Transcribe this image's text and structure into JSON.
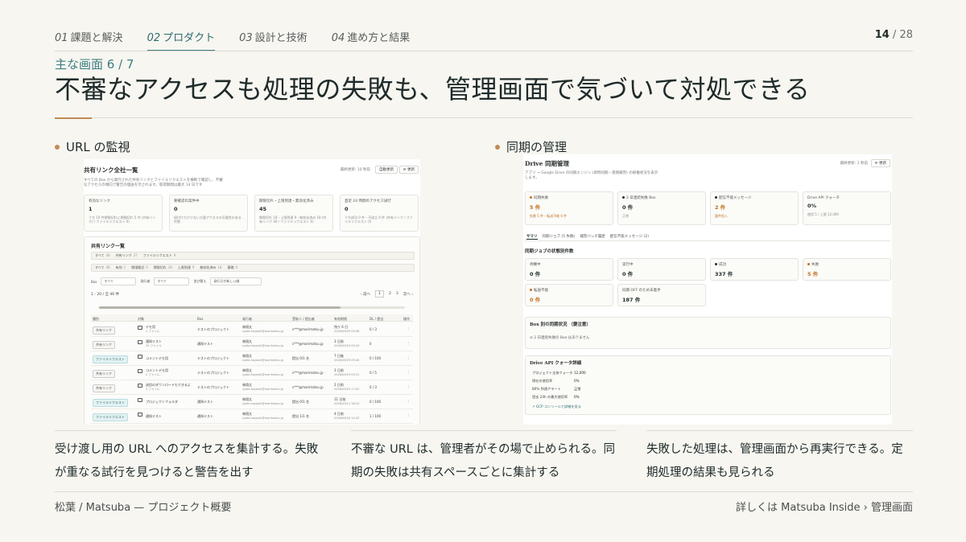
{
  "nav": {
    "tabs": [
      {
        "num": "01",
        "label": "課題と解決"
      },
      {
        "num": "02",
        "label": "プロダクト"
      },
      {
        "num": "03",
        "label": "設計と技術"
      },
      {
        "num": "04",
        "label": "進め方と結果"
      }
    ],
    "active_tab": 1,
    "page_current": "14",
    "page_sep": "/",
    "page_total": "28"
  },
  "section_label": "主な画面 6 / 7",
  "title": "不審なアクセスも処理の失敗も、管理画面で気づいて対処できる",
  "left_panel": {
    "heading": "URL の監視",
    "shot": {
      "title": "共有リンク全社一覧",
      "updated": "最終更新: 10 秒前",
      "btn_refresh_auto": "自動更新",
      "btn_refresh": "⟳ 更新",
      "desc1": "すべての Box から発行された共有リンクとファイルリクエストを横断で確認し、不審",
      "desc2": "なアクセスの傾向で警告の理由を示されます。取得期間は最大 14 日です",
      "cards": [
        {
          "label": "有効なリンク",
          "value": "1",
          "note": "うち 10 件期限切れに期間切れ 5 件 (共有リンク) / ファイルリクエスト 0)"
        },
        {
          "label": "要確認の案件中",
          "value": "0",
          "note": "紐付けだけ少ない大量アクセスの可能性のある件数"
        },
        {
          "label": "期限切れ・上限到達・無効化済み",
          "value": "45",
          "note": "期限切れ 18・上限到達 9・無効化済み 18 (共有リンク 36 / ファイルリクエスト 9)"
        },
        {
          "label": "直近 24 時間のアクセス試行",
          "value": "0",
          "note": "うち成功 0 件・不成立 0 件 (共有リンク / ファイルリクエスト 0)"
        }
      ],
      "list_title": "共有リンク一覧",
      "chips1": [
        {
          "label": "すべて",
          "count": "46"
        },
        {
          "label": "共有リンク",
          "count": "37"
        },
        {
          "label": "ファイルリクエスト",
          "count": "9"
        }
      ],
      "chips2": [
        {
          "label": "すべて",
          "count": "46"
        },
        {
          "label": "有効",
          "count": "1"
        },
        {
          "label": "期限間近",
          "count": "0"
        },
        {
          "label": "期限切れ",
          "count": "18"
        },
        {
          "label": "上限到達",
          "count": "9"
        },
        {
          "label": "無効化済み",
          "count": "18"
        },
        {
          "label": "要確",
          "count": "0"
        }
      ],
      "filter_box_label": "Box",
      "filter_box_value": "すべて",
      "filter_issuer_label": "発行者",
      "filter_issuer_value": "すべて",
      "filter_sort_label": "並び替え",
      "filter_sort_value": "発行日が新しい順",
      "range": "1 - 20 / 全 46 件",
      "prev": "前へ",
      "pages": [
        "1",
        "2",
        "3"
      ],
      "next": "次へ",
      "headers": [
        "種別",
        "対象",
        "Box",
        "発行者",
        "受取人 / 提出者",
        "有効期限",
        "DL / 提出",
        "操作"
      ],
      "rows": [
        {
          "type": "共有リンク",
          "kind": "link",
          "target": "デモ用",
          "sub": "1 ファイル",
          "box": "テストのプロジェクト",
          "issuer": "林翔太",
          "email": "syota.hayashi@morimatsu.jp",
          "recipient": "s***@morimatsu.jp",
          "exp": "残り 6 日",
          "exp2": "2026/09/29 09:08",
          "dl": "0 / 3"
        },
        {
          "type": "共有リンク",
          "kind": "link",
          "target": "通知テスト",
          "sub": "25 ファイル",
          "box": "通知テスト",
          "issuer": "林翔太",
          "email": "syota.hayashi@morimatsu.jp",
          "recipient": "s***@morimatsu.jp",
          "exp": "3 日前",
          "exp2": "2026/09/19 09:43",
          "dl": "0"
        },
        {
          "type": "ファイルリクエスト",
          "kind": "file",
          "target": "コメントデモ用",
          "sub": "",
          "box": "テストのプロジェクト",
          "issuer": "林翔太",
          "email": "syota.hayashi@morimatsu.jp",
          "recipient": "提出 0/1 名",
          "exp": "7 日後",
          "exp2": "2026/09/29 09:40",
          "dl": "0 / 100"
        },
        {
          "type": "共有リンク",
          "kind": "link",
          "target": "コメントデモ用",
          "sub": "5 ファイル",
          "box": "テストのプロジェクト",
          "issuer": "林翔太",
          "email": "syota.hayashi@morimatsu.jp",
          "recipient": "s***@morimatsu.jp",
          "exp": "3 日前",
          "exp2": "2026/09/19 09:31",
          "dl": "0 / 5"
        },
        {
          "type": "共有リンク",
          "kind": "link",
          "target": "送信のダウンロードもできるよ",
          "sub": "3 ファイル",
          "box": "テストのプロジェクト",
          "issuer": "林翔太",
          "email": "syota.hayashi@morimatsu.jp",
          "recipient": "s***@morimatsu.jp",
          "exp": "2 日前",
          "exp2": "2026/09/15 17:02",
          "dl": "0 / 3"
        },
        {
          "type": "ファイルリクエスト",
          "kind": "file",
          "target": "プロジェクトフォルダ",
          "sub": "",
          "box": "通知テスト",
          "issuer": "林翔太",
          "email": "syota.hayashi@morimatsu.jp",
          "recipient": "提出 0/1 名",
          "exp": "11 日前",
          "exp2": "2026/09/11 16:10",
          "dl": "0 / 100"
        },
        {
          "type": "ファイルリクエスト",
          "kind": "file",
          "target": "通知テスト",
          "sub": "",
          "box": "通知テスト",
          "issuer": "林翔太",
          "email": "syota.hayashi@morimatsu.jp",
          "recipient": "提出 1/1 名",
          "exp": "4 日前",
          "exp2": "2026/09/18 14:43",
          "dl": "1 / 100"
        }
      ]
    }
  },
  "right_panel": {
    "heading": "同期の管理",
    "shot": {
      "title": "Drive 同期管理",
      "updated": "最終更新: 1 秒前",
      "btn_refresh": "⟳ 更新",
      "desc1": "アプリ → Google Drive の同期エンジン (即時同期・夜間補完) の稼働状況を表示",
      "desc2": "します。",
      "cards": [
        {
          "label": "同期失敗",
          "value": "5 件",
          "note": "失敗 5 件・転送不能 0 件",
          "accent": true
        },
        {
          "label": "2 日連続失敗 Box",
          "value": "0 件",
          "note": "正常",
          "accent": false
        },
        {
          "label": "配信不能メッセージ",
          "value": "2 件",
          "note": "要件投入",
          "accent": true
        },
        {
          "label": "Drive API クォータ",
          "value": "0%",
          "note": "使用 5 / 上限 12,000",
          "accent": false
        }
      ],
      "tabs": [
        "サマリ",
        "同期ジョブ (5 失敗)",
        "補完バッチ履歴",
        "配信不能メッセージ (2)"
      ],
      "job_title": "同期ジョブの状態別件数",
      "job_cards": [
        {
          "label": "待機中",
          "value": "0 件",
          "accent": false
        },
        {
          "label": "実行中",
          "value": "0 件",
          "accent": false
        },
        {
          "label": "成功",
          "value": "337 件",
          "accent": false
        },
        {
          "label": "失敗",
          "value": "5 件",
          "accent": true
        },
        {
          "label": "転送不能",
          "value": "0 件",
          "accent": true
        },
        {
          "label": "同期 OFF のため未着手",
          "value": "187 件",
          "accent": false
        }
      ],
      "box_title": "Box 別の同期状況 （要注意）",
      "box_note": "2 日連続失敗の Box はありません",
      "quota_title": "Drive API クォータ詳細",
      "quota_rows": [
        {
          "k": "プロジェクト全体クォータ",
          "v": "12,000"
        },
        {
          "k": "現在の使用率",
          "v": "0%"
        },
        {
          "k": "80% 到達アラート",
          "v": "正常"
        },
        {
          "k": "過去 24h の最大使用率",
          "v": "0%"
        }
      ],
      "quota_link": "GCP コンソールで詳細を見る"
    }
  },
  "captions": [
    "受け渡し用の URL へのアクセスを集計する。失敗が重なる試行を見つけると警告を出す",
    "不審な URL は、管理者がその場で止められる。同期の失敗は共有スペースごとに集計する",
    "失敗した処理は、管理画面から再実行できる。定期処理の結果も見られる"
  ],
  "footer": {
    "left": "松葉 / Matsuba — プロジェクト概要",
    "right": "詳しくは Matsuba Inside › 管理画面"
  }
}
